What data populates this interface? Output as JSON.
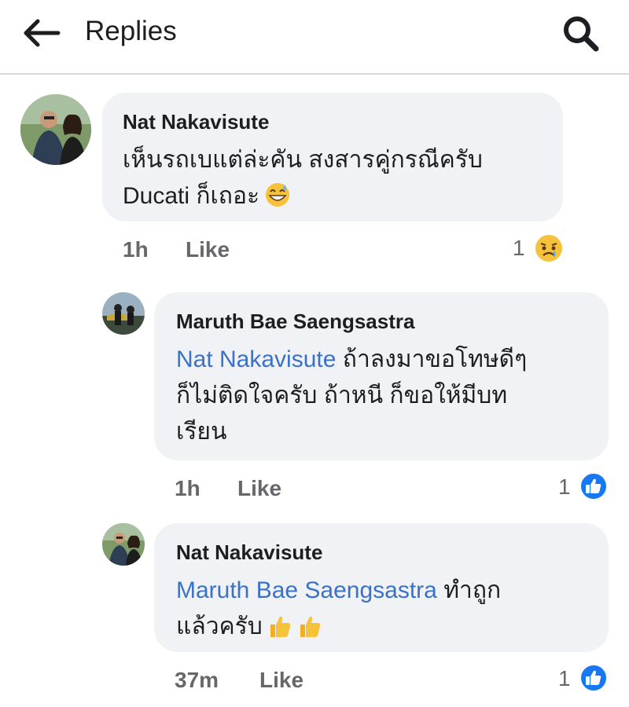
{
  "header": {
    "title": "Replies"
  },
  "comments": [
    {
      "author": "Nat Nakavisute",
      "text_line1": "เห็นรถเบแต่ล่ะคัน สงสารคู่กรณีครับ",
      "text_line2": "Ducati ก็เถอะ",
      "emoji": "grinning-sweat-emoji",
      "time": "1h",
      "like_label": "Like",
      "reaction_count": "1",
      "reaction": "sad"
    },
    {
      "author": "Maruth Bae Saengsastra",
      "mention": "Nat Nakavisute",
      "text_line1_rest": "ถ้าลงมาขอโทษดีๆ",
      "text_line2": "ก็ไม่ติดใจครับ ถ้าหนี ก็ขอให้มีบท",
      "text_line3": "เรียน",
      "time": "1h",
      "like_label": "Like",
      "reaction_count": "1",
      "reaction": "like"
    },
    {
      "author": "Nat Nakavisute",
      "mention": "Maruth Bae Saengsastra",
      "text_line1_rest": "ทำถูก",
      "text_line2": "แล้วครับ",
      "emoji": "thumbs-up-emoji",
      "time": "37m",
      "like_label": "Like",
      "reaction_count": "1",
      "reaction": "like"
    }
  ],
  "colors": {
    "mention": "#3a72c8",
    "bubble": "#f0f2f5",
    "like_blue": "#1877f2",
    "meta": "#65676b"
  }
}
